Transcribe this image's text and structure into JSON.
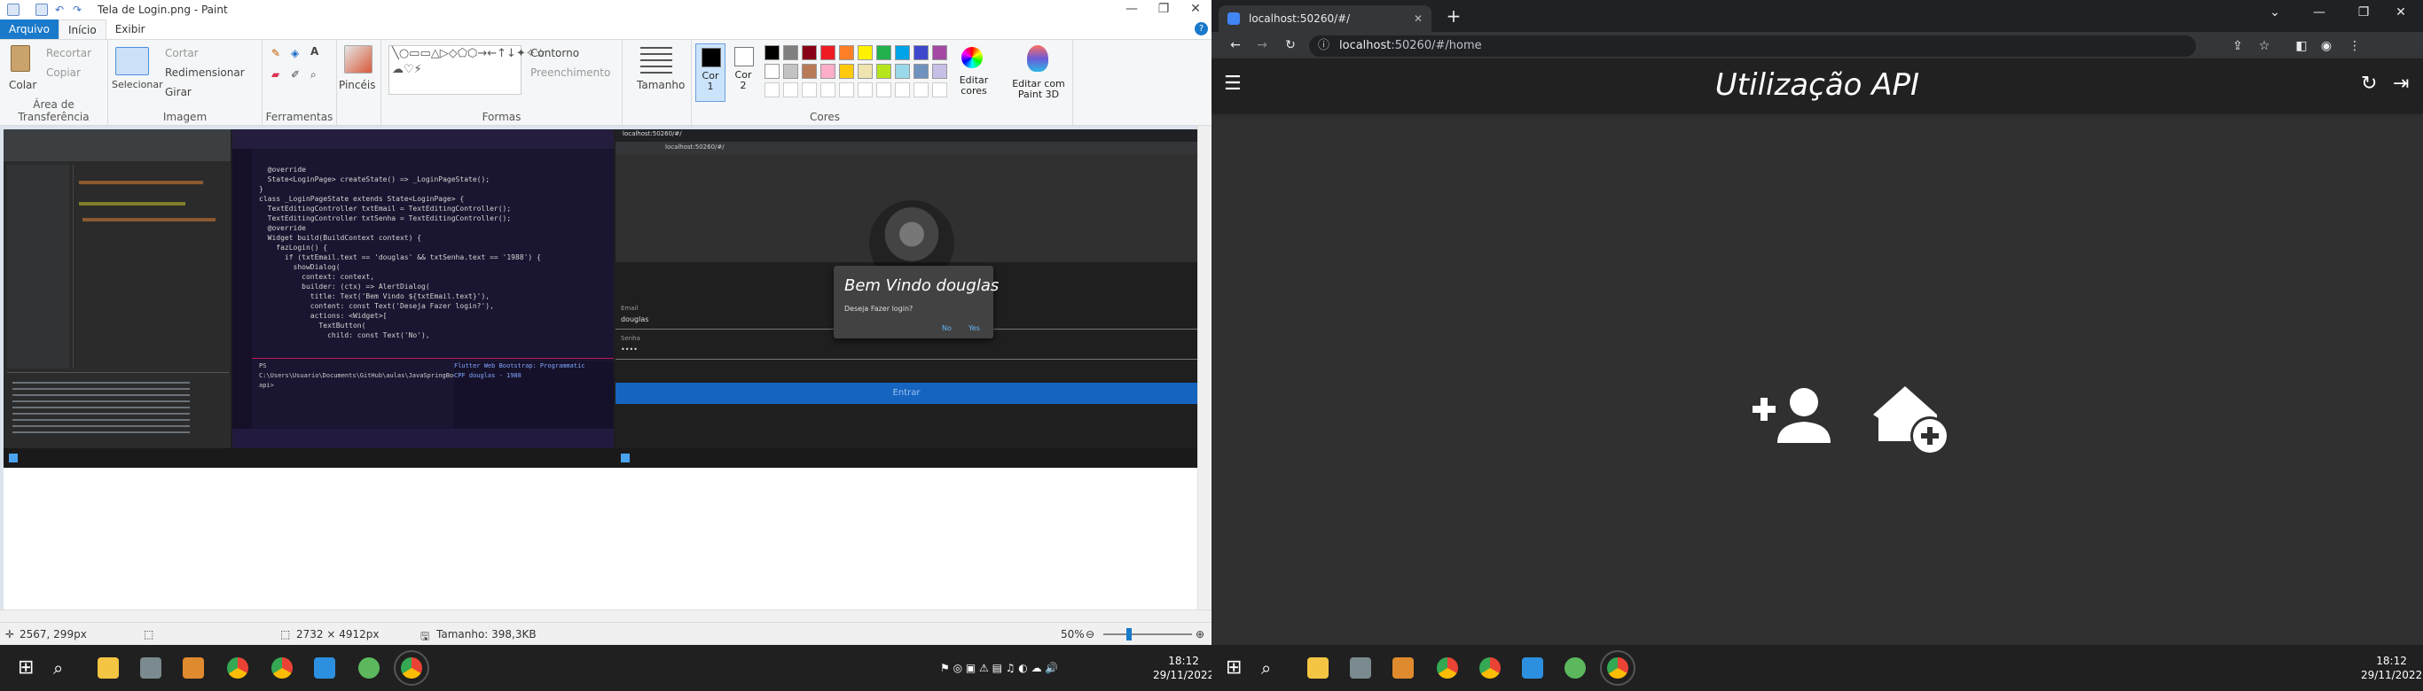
{
  "paint": {
    "title": "Tela de Login.png - Paint",
    "tabs": [
      "Arquivo",
      "Início",
      "Exibir"
    ],
    "clipboard": {
      "paste": "Colar",
      "cut": "Recortar",
      "copy": "Copiar",
      "group": "Área de Transferência"
    },
    "image": {
      "select": "Selecionar",
      "crop": "Cortar",
      "resize": "Redimensionar",
      "rotate": "Girar",
      "group": "Imagem"
    },
    "tools": {
      "group": "Ferramentas"
    },
    "brushes": {
      "label": "Pincéis"
    },
    "shapes": {
      "outline": "Contorno",
      "fill": "Preenchimento",
      "group": "Formas"
    },
    "size": {
      "label": "Tamanho"
    },
    "color1": "Cor\n1",
    "color2": "Cor\n2",
    "colors": {
      "edit": "Editar\ncores",
      "group": "Cores",
      "paint3d": "Editar com\nPaint 3D"
    },
    "palette": [
      "#000000",
      "#7f7f7f",
      "#880015",
      "#ed1c24",
      "#ff7f27",
      "#fff200",
      "#22b14c",
      "#00a2e8",
      "#3f48cc",
      "#a349a4",
      "#ffffff",
      "#c3c3c3",
      "#b97a57",
      "#ffaec9",
      "#ffc90e",
      "#efe4b0",
      "#b5e61d",
      "#99d9ea",
      "#7092be",
      "#c8bfe7"
    ],
    "status": {
      "cursor": "2567, 299px",
      "dims": "2732 × 4912px",
      "size": "Tamanho: 398,3KB",
      "zoom": "50%"
    },
    "shot": {
      "browser_url": "localhost:50260/#/",
      "dialog_title": "Bem Vindo douglas",
      "dialog_body": "Deseja Fazer login?",
      "dialog_no": "No",
      "dialog_yes": "Yes",
      "email_label": "Email",
      "email_value": "douglas",
      "pass_label": "Senha",
      "pass_value": "••••",
      "enter": "Entrar",
      "code": [
        "  @override",
        "  State<LoginPage> createState() => _LoginPageState();",
        "}",
        "",
        "class _LoginPageState extends State<LoginPage> {",
        "  TextEditingController txtEmail = TextEditingController();",
        "  TextEditingController txtSenha = TextEditingController();",
        "",
        "  @override",
        "  Widget build(BuildContext context) {",
        "    fazLogin() {",
        "      if (txtEmail.text == 'douglas' && txtSenha.text == '1988') {",
        "",
        "        showDialog(",
        "          context: context,",
        "          builder: (ctx) => AlertDialog(",
        "            title: Text('Bem Vindo ${txtEmail.text}'),",
        "            content: const Text('Deseja Fazer login?'),",
        "            actions: <Widget>[",
        "              TextButton(",
        "                child: const Text('No'),"
      ],
      "terminal": "PS C:\\Users\\Usuario\\Documents\\GitHub\\aulas\\JavaSpringBoot\\flutter\\12-api>",
      "debug": [
        "Flutter Web Bootstrap: Programmatic",
        "CPF douglas - 1988"
      ]
    },
    "taskbar": {
      "time": "18:12",
      "date": "29/11/2022"
    }
  },
  "chrome": {
    "tab_title": "localhost:50260/#/",
    "url_host": "localhost",
    "url_rest": ":50260/#/home",
    "app_title": "Utilização API",
    "taskbar": {
      "time": "18:12",
      "date": "29/11/2022"
    }
  },
  "colors": {
    "paint_file_tab": "#1979ca",
    "app_bar": "#212121",
    "app_bg": "#303030",
    "accent": "#4285f4"
  }
}
